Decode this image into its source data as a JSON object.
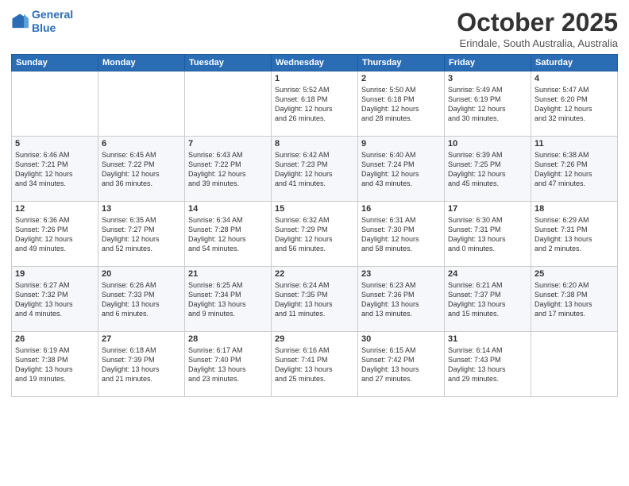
{
  "header": {
    "logo_line1": "General",
    "logo_line2": "Blue",
    "month": "October 2025",
    "location": "Erindale, South Australia, Australia"
  },
  "days_of_week": [
    "Sunday",
    "Monday",
    "Tuesday",
    "Wednesday",
    "Thursday",
    "Friday",
    "Saturday"
  ],
  "weeks": [
    [
      {
        "day": "",
        "info": ""
      },
      {
        "day": "",
        "info": ""
      },
      {
        "day": "",
        "info": ""
      },
      {
        "day": "1",
        "info": "Sunrise: 5:52 AM\nSunset: 6:18 PM\nDaylight: 12 hours\nand 26 minutes."
      },
      {
        "day": "2",
        "info": "Sunrise: 5:50 AM\nSunset: 6:18 PM\nDaylight: 12 hours\nand 28 minutes."
      },
      {
        "day": "3",
        "info": "Sunrise: 5:49 AM\nSunset: 6:19 PM\nDaylight: 12 hours\nand 30 minutes."
      },
      {
        "day": "4",
        "info": "Sunrise: 5:47 AM\nSunset: 6:20 PM\nDaylight: 12 hours\nand 32 minutes."
      }
    ],
    [
      {
        "day": "5",
        "info": "Sunrise: 6:46 AM\nSunset: 7:21 PM\nDaylight: 12 hours\nand 34 minutes."
      },
      {
        "day": "6",
        "info": "Sunrise: 6:45 AM\nSunset: 7:22 PM\nDaylight: 12 hours\nand 36 minutes."
      },
      {
        "day": "7",
        "info": "Sunrise: 6:43 AM\nSunset: 7:22 PM\nDaylight: 12 hours\nand 39 minutes."
      },
      {
        "day": "8",
        "info": "Sunrise: 6:42 AM\nSunset: 7:23 PM\nDaylight: 12 hours\nand 41 minutes."
      },
      {
        "day": "9",
        "info": "Sunrise: 6:40 AM\nSunset: 7:24 PM\nDaylight: 12 hours\nand 43 minutes."
      },
      {
        "day": "10",
        "info": "Sunrise: 6:39 AM\nSunset: 7:25 PM\nDaylight: 12 hours\nand 45 minutes."
      },
      {
        "day": "11",
        "info": "Sunrise: 6:38 AM\nSunset: 7:26 PM\nDaylight: 12 hours\nand 47 minutes."
      }
    ],
    [
      {
        "day": "12",
        "info": "Sunrise: 6:36 AM\nSunset: 7:26 PM\nDaylight: 12 hours\nand 49 minutes."
      },
      {
        "day": "13",
        "info": "Sunrise: 6:35 AM\nSunset: 7:27 PM\nDaylight: 12 hours\nand 52 minutes."
      },
      {
        "day": "14",
        "info": "Sunrise: 6:34 AM\nSunset: 7:28 PM\nDaylight: 12 hours\nand 54 minutes."
      },
      {
        "day": "15",
        "info": "Sunrise: 6:32 AM\nSunset: 7:29 PM\nDaylight: 12 hours\nand 56 minutes."
      },
      {
        "day": "16",
        "info": "Sunrise: 6:31 AM\nSunset: 7:30 PM\nDaylight: 12 hours\nand 58 minutes."
      },
      {
        "day": "17",
        "info": "Sunrise: 6:30 AM\nSunset: 7:31 PM\nDaylight: 13 hours\nand 0 minutes."
      },
      {
        "day": "18",
        "info": "Sunrise: 6:29 AM\nSunset: 7:31 PM\nDaylight: 13 hours\nand 2 minutes."
      }
    ],
    [
      {
        "day": "19",
        "info": "Sunrise: 6:27 AM\nSunset: 7:32 PM\nDaylight: 13 hours\nand 4 minutes."
      },
      {
        "day": "20",
        "info": "Sunrise: 6:26 AM\nSunset: 7:33 PM\nDaylight: 13 hours\nand 6 minutes."
      },
      {
        "day": "21",
        "info": "Sunrise: 6:25 AM\nSunset: 7:34 PM\nDaylight: 13 hours\nand 9 minutes."
      },
      {
        "day": "22",
        "info": "Sunrise: 6:24 AM\nSunset: 7:35 PM\nDaylight: 13 hours\nand 11 minutes."
      },
      {
        "day": "23",
        "info": "Sunrise: 6:23 AM\nSunset: 7:36 PM\nDaylight: 13 hours\nand 13 minutes."
      },
      {
        "day": "24",
        "info": "Sunrise: 6:21 AM\nSunset: 7:37 PM\nDaylight: 13 hours\nand 15 minutes."
      },
      {
        "day": "25",
        "info": "Sunrise: 6:20 AM\nSunset: 7:38 PM\nDaylight: 13 hours\nand 17 minutes."
      }
    ],
    [
      {
        "day": "26",
        "info": "Sunrise: 6:19 AM\nSunset: 7:38 PM\nDaylight: 13 hours\nand 19 minutes."
      },
      {
        "day": "27",
        "info": "Sunrise: 6:18 AM\nSunset: 7:39 PM\nDaylight: 13 hours\nand 21 minutes."
      },
      {
        "day": "28",
        "info": "Sunrise: 6:17 AM\nSunset: 7:40 PM\nDaylight: 13 hours\nand 23 minutes."
      },
      {
        "day": "29",
        "info": "Sunrise: 6:16 AM\nSunset: 7:41 PM\nDaylight: 13 hours\nand 25 minutes."
      },
      {
        "day": "30",
        "info": "Sunrise: 6:15 AM\nSunset: 7:42 PM\nDaylight: 13 hours\nand 27 minutes."
      },
      {
        "day": "31",
        "info": "Sunrise: 6:14 AM\nSunset: 7:43 PM\nDaylight: 13 hours\nand 29 minutes."
      },
      {
        "day": "",
        "info": ""
      }
    ]
  ]
}
